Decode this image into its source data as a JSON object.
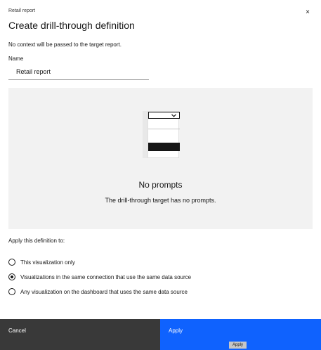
{
  "dialog": {
    "eyebrow": "Retail report",
    "title": "Create drill-through definition",
    "close_icon": "×",
    "info_text": "No context will be passed to the target report."
  },
  "name_field": {
    "label": "Name",
    "value": "Retail report"
  },
  "prompts": {
    "title": "No prompts",
    "description": "The drill-through target has no prompts."
  },
  "scope": {
    "label": "Apply this definition to:",
    "options": [
      {
        "label": "This visualization only",
        "selected": false
      },
      {
        "label": "Visualizations in the same connection that use the same data source",
        "selected": true
      },
      {
        "label": "Any visualization on the dashboard that uses the same data source",
        "selected": false
      }
    ]
  },
  "footer": {
    "cancel_label": "Cancel",
    "apply_label": "Apply",
    "apply_tooltip": "Apply"
  },
  "colors": {
    "primary": "#0f62fe",
    "secondary": "#393939",
    "panel": "#f2f2f2"
  }
}
